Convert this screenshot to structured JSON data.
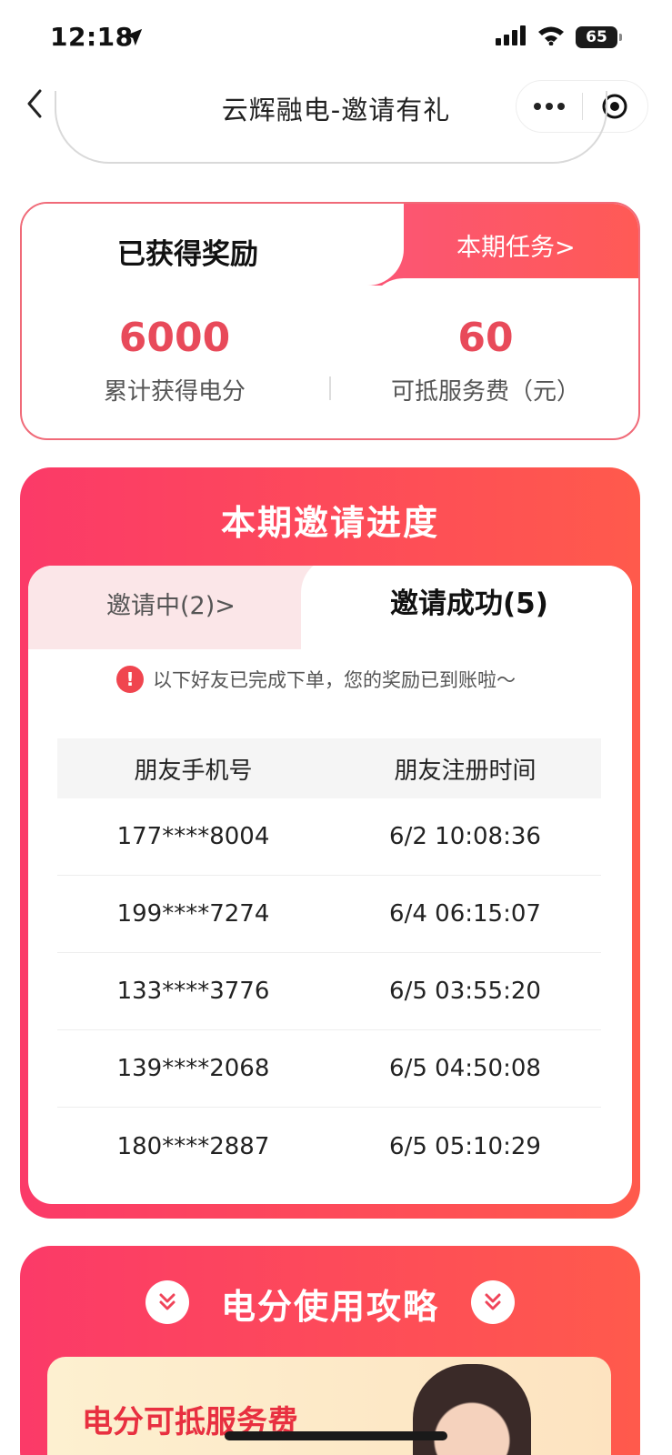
{
  "status_bar": {
    "time": "12:18",
    "battery": "65"
  },
  "nav": {
    "title": "云辉融电-邀请有礼"
  },
  "reward": {
    "title": "已获得奖励",
    "task_link": "本期任务>",
    "stats": [
      {
        "value": "6000",
        "label": "累计获得电分"
      },
      {
        "value": "60",
        "label": "可抵服务费（元）"
      }
    ]
  },
  "progress": {
    "title": "本期邀请进度",
    "tabs": [
      {
        "label": "邀请中(2)>"
      },
      {
        "label": "邀请成功(5)"
      }
    ],
    "notice": "以下好友已完成下单，您的奖励已到账啦～",
    "table": {
      "headers": [
        "朋友手机号",
        "朋友注册时间"
      ],
      "rows": [
        [
          "177****8004",
          "6/2 10:08:36"
        ],
        [
          "199****7274",
          "6/4 06:15:07"
        ],
        [
          "133****3776",
          "6/5 03:55:20"
        ],
        [
          "139****2068",
          "6/5 04:50:08"
        ],
        [
          "180****2887",
          "6/5 05:10:29"
        ]
      ]
    }
  },
  "guide": {
    "title": "电分使用攻略",
    "banner_text": "电分可抵服务费"
  },
  "colors": {
    "accent": "#fb3a68",
    "accent2": "#ff5a4c",
    "value_red": "#e84a5a"
  },
  "icons": [
    "location-arrow-icon",
    "signal-icon",
    "wifi-icon",
    "battery-icon",
    "back-chevron-icon",
    "more-dots-icon",
    "target-icon",
    "warning-icon",
    "double-chevron-down-icon"
  ]
}
